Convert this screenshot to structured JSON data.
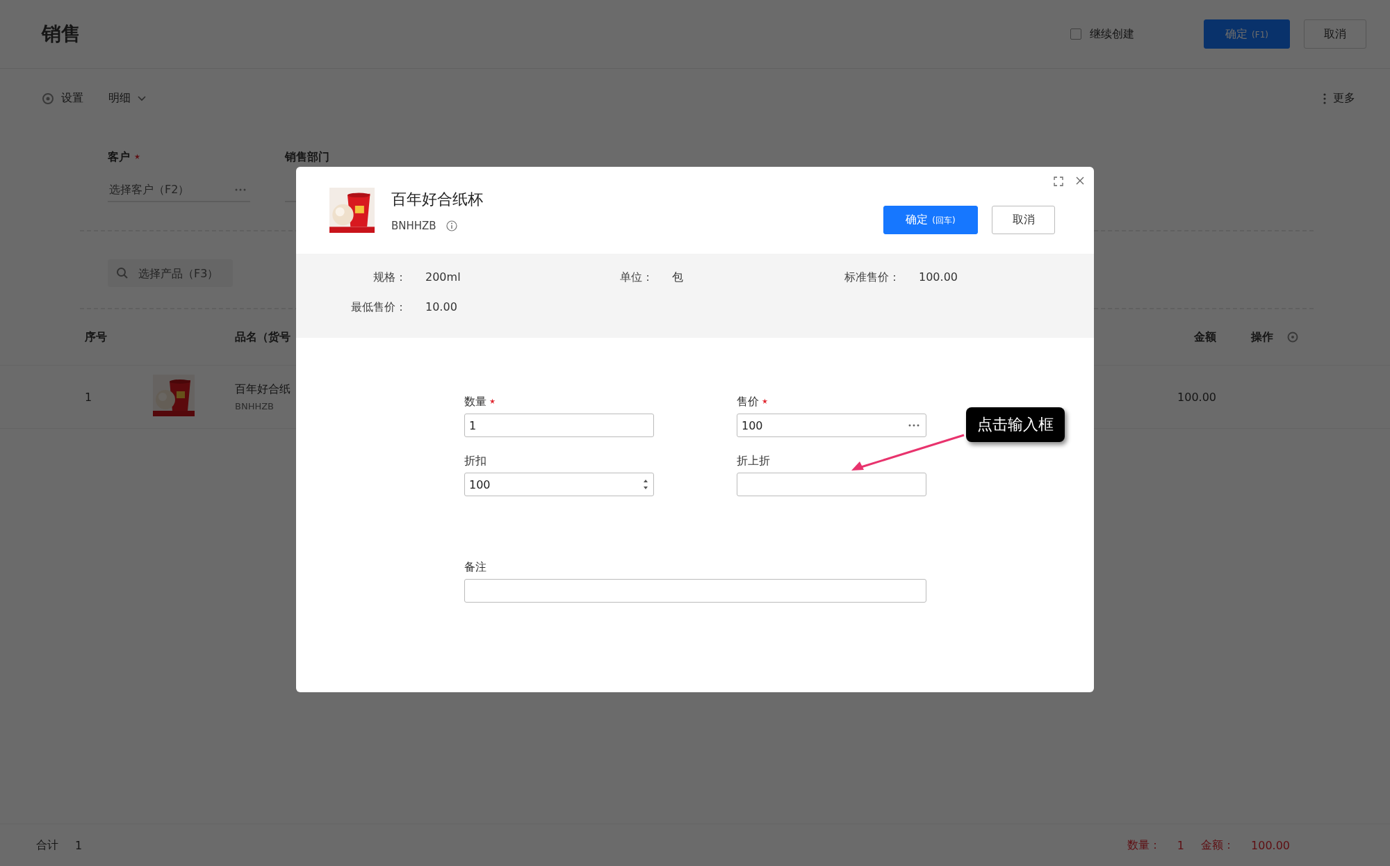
{
  "page": {
    "title": "销售",
    "continue_create": {
      "label": "继续创建",
      "checked": false
    },
    "buttons": [
      {
        "label": "确定",
        "hint": "(F1)",
        "kind": "primary"
      },
      {
        "label": "取消",
        "kind": "default"
      }
    ],
    "toolbar": {
      "items": [
        {
          "label": "设置",
          "kind": "settings"
        },
        {
          "label": "明细",
          "kind": "dropdown"
        }
      ],
      "more": "更多"
    },
    "form": {
      "fields": [
        {
          "label": "客户",
          "required": true,
          "placeholder": "选择客户（F2）",
          "kind": "picker"
        },
        {
          "label": "销售部门",
          "required": false,
          "kind": "select"
        }
      ]
    },
    "product_search": {
      "placeholder": "选择产品（F3）"
    },
    "table": {
      "columns": [
        "序号",
        "品名（货号",
        "金额",
        "操作"
      ],
      "rows": [
        {
          "index": "1",
          "name": "百年好合纸",
          "code": "BNHHZB",
          "amount": "100.00"
        }
      ]
    },
    "footer": {
      "total_label": "合计",
      "total_count": "1",
      "quantity_label": "数量：",
      "quantity": "1",
      "amount_label": "金额：",
      "amount": "100.00"
    }
  },
  "dialog": {
    "title": "百年好合纸杯",
    "code": "BNHHZB",
    "buttons": [
      {
        "label": "确定",
        "hint": "(回车)",
        "kind": "primary"
      },
      {
        "label": "取消",
        "kind": "default"
      }
    ],
    "info": [
      {
        "label": "规格：",
        "value": "200ml"
      },
      {
        "label": "单位：",
        "value": "包"
      },
      {
        "label": "标准售价：",
        "value": "100.00"
      },
      {
        "label": "最低售价：",
        "value": "10.00"
      }
    ],
    "fields": [
      {
        "label": "数量",
        "required": true,
        "value": "1",
        "kind": "text"
      },
      {
        "label": "售价",
        "required": true,
        "value": "100",
        "kind": "picker"
      },
      {
        "label": "折扣",
        "required": false,
        "value": "100",
        "kind": "number"
      },
      {
        "label": "折上折",
        "required": false,
        "kind": "text"
      },
      {
        "label": "备注",
        "required": false,
        "kind": "wide"
      }
    ],
    "tooltip": "点击输入框"
  }
}
